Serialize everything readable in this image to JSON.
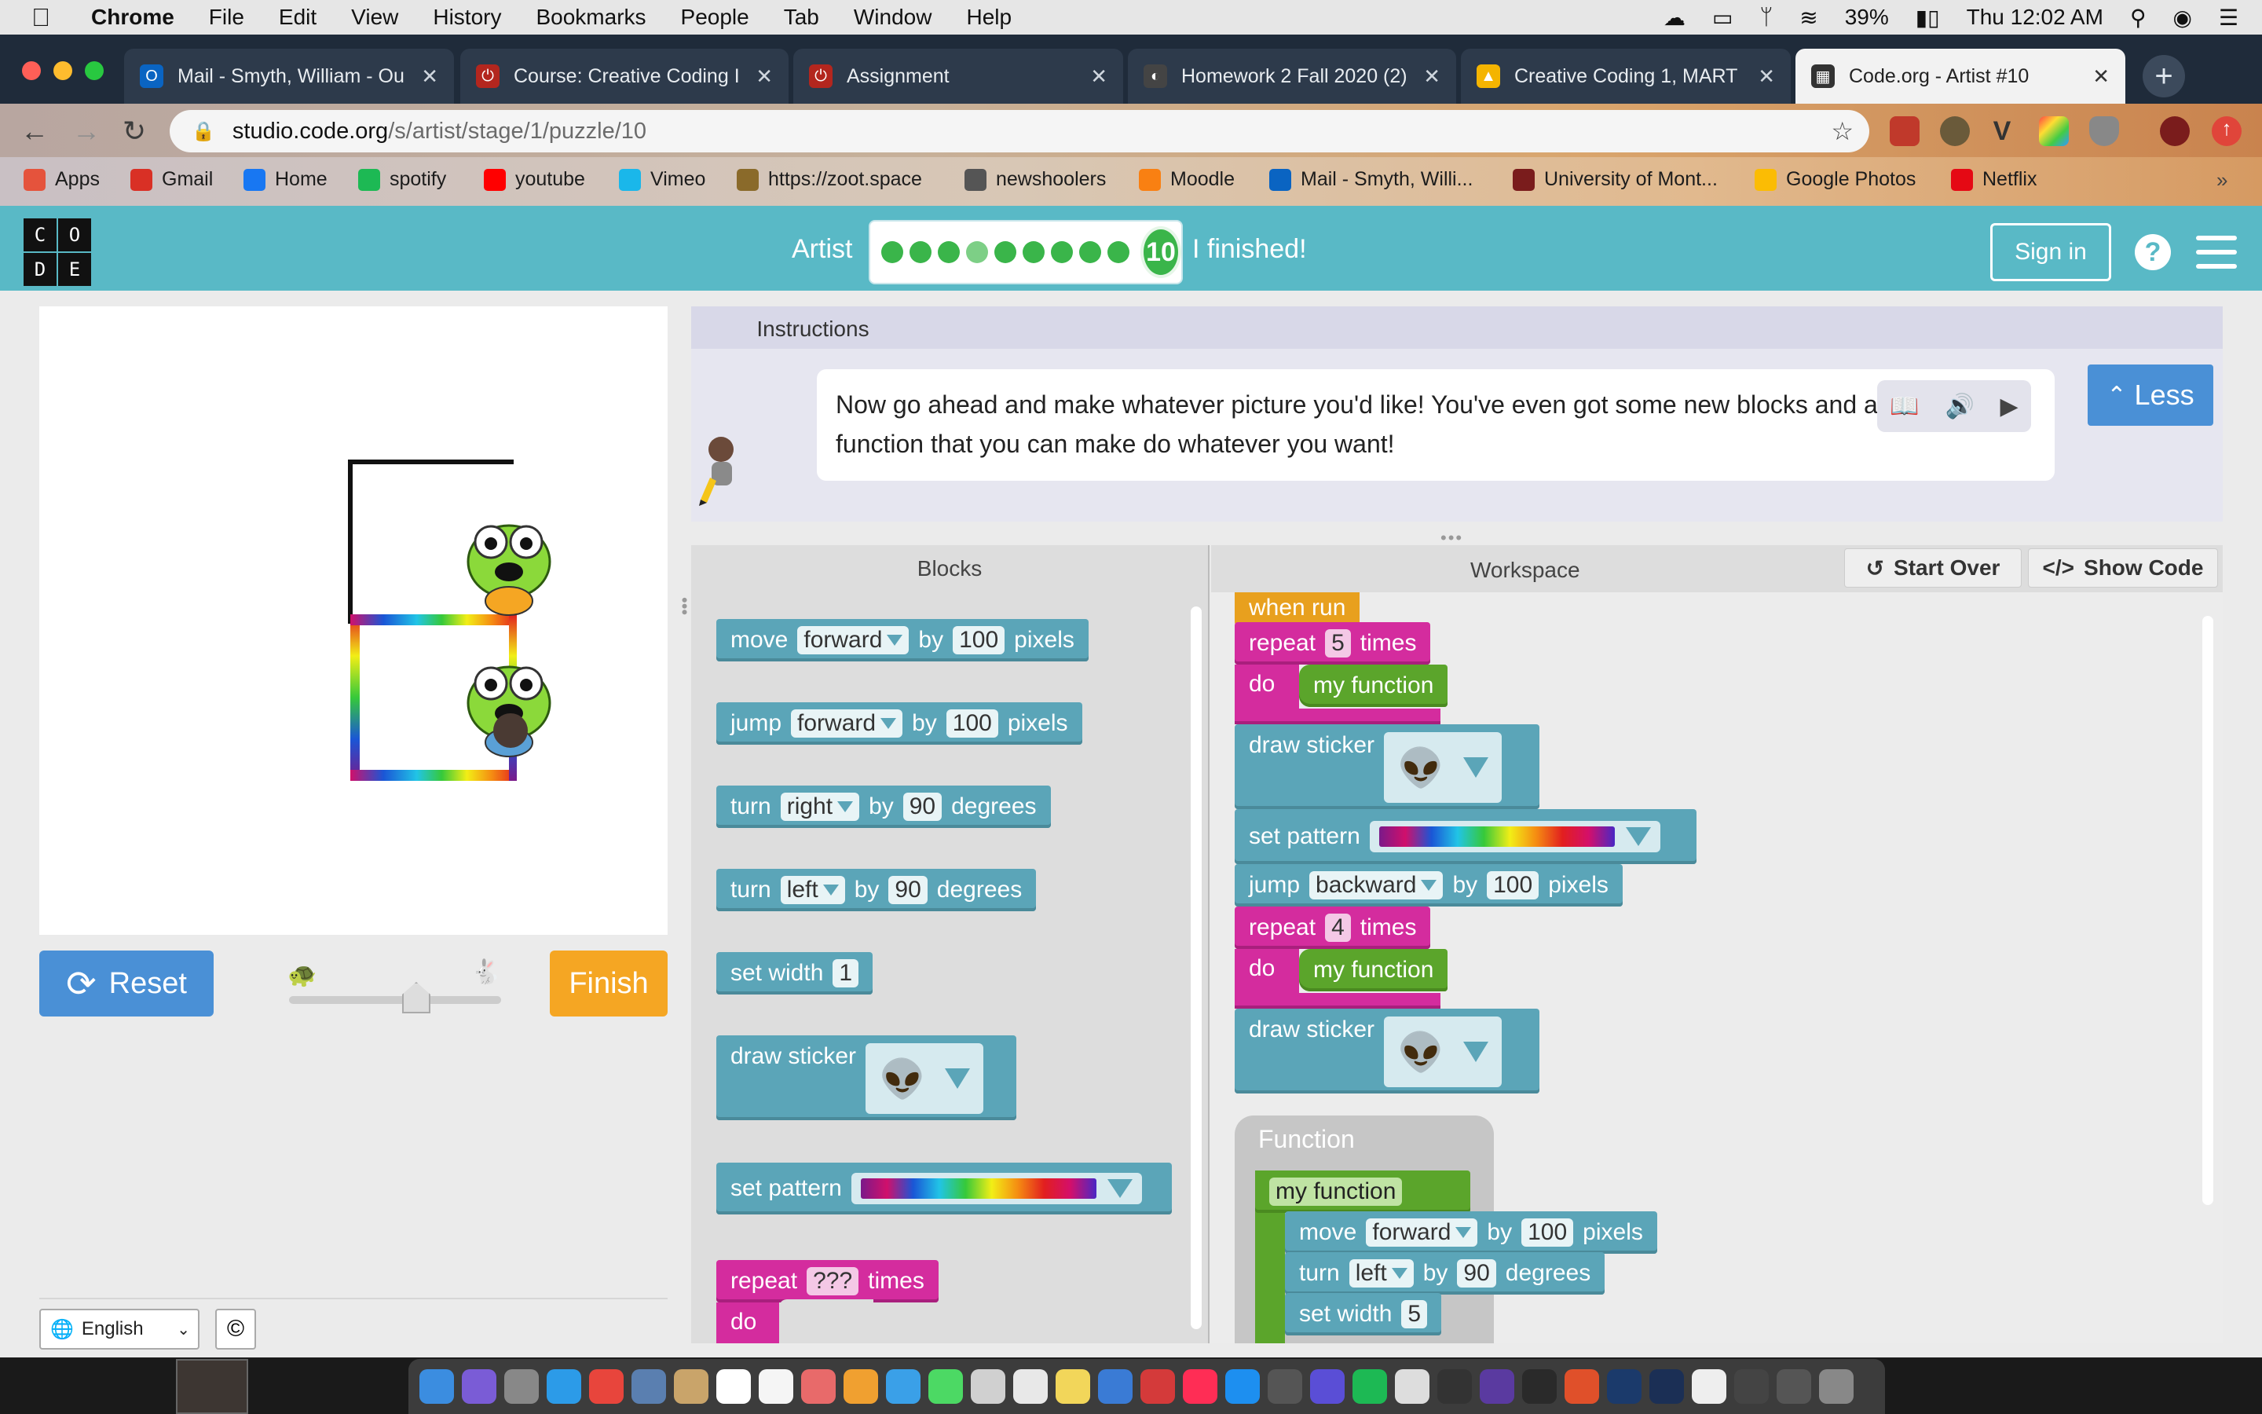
{
  "menubar": {
    "app": "Chrome",
    "items": [
      "File",
      "Edit",
      "View",
      "History",
      "Bookmarks",
      "People",
      "Tab",
      "Window",
      "Help"
    ],
    "battery": "39%",
    "clock": "Thu 12:02 AM"
  },
  "tabs": [
    {
      "title": "Mail - Smyth, William - Ou",
      "icon_color": "#0a64c2",
      "icon_label": "O"
    },
    {
      "title": "Course: Creative Coding I",
      "icon_color": "#b3261e",
      "icon_label": "⏻"
    },
    {
      "title": "Assignment",
      "icon_color": "#b3261e",
      "icon_label": "⏻"
    },
    {
      "title": "Homework 2 Fall 2020 (2)",
      "icon_color": "#444444",
      "icon_label": "◐"
    },
    {
      "title": "Creative Coding 1, MART 1",
      "icon_color": "#f4b400",
      "icon_label": "▲"
    },
    {
      "title": "Code.org - Artist #10",
      "icon_color": "#333333",
      "icon_label": "▦"
    }
  ],
  "address": {
    "host": "studio.code.org",
    "path": "/s/artist/stage/1/puzzle/10"
  },
  "bookmarks": [
    {
      "label": "Apps",
      "icon": "apps-grid-icon",
      "color": "#e5533c"
    },
    {
      "label": "Gmail",
      "icon": "gmail-icon",
      "color": "#d93025"
    },
    {
      "label": "Home",
      "icon": "facebook-icon",
      "color": "#1877f2"
    },
    {
      "label": "spotify",
      "icon": "spotify-icon",
      "color": "#1db954"
    },
    {
      "label": "youtube",
      "icon": "youtube-icon",
      "color": "#ff0000"
    },
    {
      "label": "Vimeo",
      "icon": "vimeo-icon",
      "color": "#1ab7ea"
    },
    {
      "label": "https://zoot.space",
      "icon": "zoot-icon",
      "color": "#8a6a2a"
    },
    {
      "label": "newshoolers",
      "icon": "newschoolers-icon",
      "color": "#555555"
    },
    {
      "label": "Moodle",
      "icon": "moodle-icon",
      "color": "#f98012"
    },
    {
      "label": "Mail - Smyth, Willi...",
      "icon": "outlook-icon",
      "color": "#0a64c2"
    },
    {
      "label": "University of Mont...",
      "icon": "university-icon",
      "color": "#7a1c1c"
    },
    {
      "label": "Google Photos",
      "icon": "google-photos-icon",
      "color": "#fbbc04"
    },
    {
      "label": "Netflix",
      "icon": "netflix-icon",
      "color": "#e50914"
    }
  ],
  "codeorg": {
    "logo": [
      "C",
      "O",
      "D",
      "E"
    ],
    "artist_label": "Artist",
    "level_number": "10",
    "finished_label": "I finished!",
    "sign_in": "Sign in",
    "help": "?",
    "completed_dots": 9,
    "current_dot": 4
  },
  "left": {
    "reset_label": "Reset",
    "finish_label": "Finish",
    "language": "English",
    "copyright": "©",
    "speed_level": 0.6
  },
  "instructions": {
    "tab": "Instructions",
    "text": "Now go ahead and make whatever picture you'd like! You've even got some new blocks and an empty function that you can make do whatever you want!",
    "less_label": "Less"
  },
  "panels": {
    "blocks_title": "Blocks",
    "workspace_title": "Workspace",
    "start_over": "Start Over",
    "show_code": "Show Code"
  },
  "toolbox": {
    "move": {
      "verb": "move",
      "dir": "forward",
      "by": "by",
      "value": "100",
      "unit": "pixels"
    },
    "jump": {
      "verb": "jump",
      "dir": "forward",
      "by": "by",
      "value": "100",
      "unit": "pixels"
    },
    "turn_right": {
      "verb": "turn",
      "dir": "right",
      "by": "by",
      "value": "90",
      "unit": "degrees"
    },
    "turn_left": {
      "verb": "turn",
      "dir": "left",
      "by": "by",
      "value": "90",
      "unit": "degrees"
    },
    "set_width": {
      "label": "set width",
      "value": "1"
    },
    "draw_sticker": {
      "label": "draw sticker"
    },
    "set_pattern": {
      "label": "set pattern"
    },
    "repeat": {
      "label": "repeat",
      "value": "???",
      "times": "times",
      "do": "do"
    }
  },
  "workspace": {
    "when_run": "when run",
    "repeat1": {
      "label": "repeat",
      "value": "5",
      "times": "times",
      "do": "do",
      "call": "my function"
    },
    "sticker1": "draw sticker",
    "pattern": "set pattern",
    "jump": {
      "verb": "jump",
      "dir": "backward",
      "by": "by",
      "value": "100",
      "unit": "pixels"
    },
    "repeat2": {
      "label": "repeat",
      "value": "4",
      "times": "times",
      "do": "do",
      "call": "my function"
    },
    "sticker2": "draw sticker",
    "function_title": "Function",
    "function_name": "my function",
    "fn_move": {
      "verb": "move",
      "dir": "forward",
      "by": "by",
      "value": "100",
      "unit": "pixels"
    },
    "fn_turn": {
      "verb": "turn",
      "dir": "left",
      "by": "by",
      "value": "90",
      "unit": "degrees"
    },
    "fn_width": {
      "label": "set width",
      "value": "5"
    }
  }
}
